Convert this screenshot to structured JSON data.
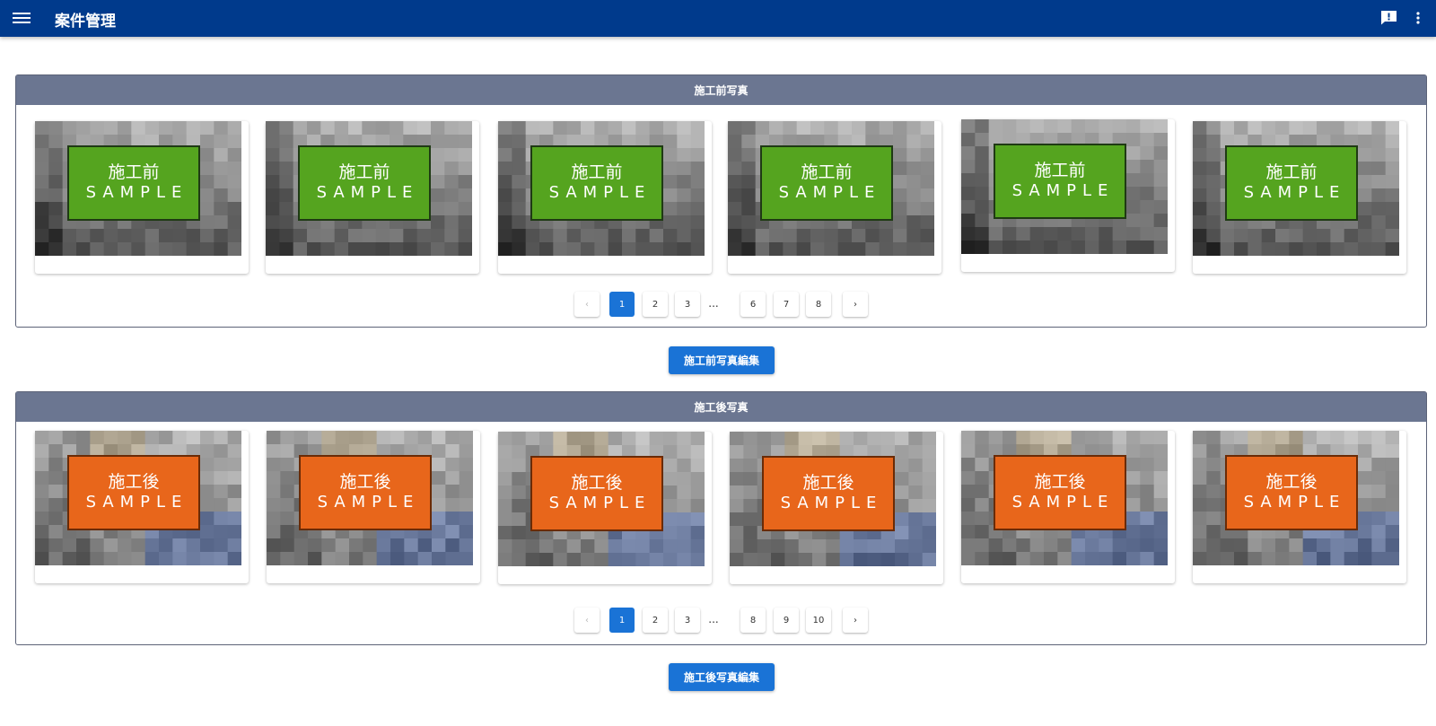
{
  "appbar": {
    "title": "案件管理",
    "menu_icon": "menu-icon",
    "feedback_icon": "feedback-icon",
    "more_icon": "more-vert-icon",
    "color": "#003a8c"
  },
  "before": {
    "header": "施工前写真",
    "photos": [
      {
        "line1": "施工前",
        "line2": "SAMPLE"
      },
      {
        "line1": "施工前",
        "line2": "SAMPLE"
      },
      {
        "line1": "施工前",
        "line2": "SAMPLE"
      },
      {
        "line1": "施工前",
        "line2": "SAMPLE"
      },
      {
        "line1": "施工前",
        "line2": "SAMPLE"
      },
      {
        "line1": "施工前",
        "line2": "SAMPLE"
      }
    ],
    "label_color": "#55a41f",
    "pager": {
      "prev": "‹",
      "pages": [
        "1",
        "2",
        "3",
        "6",
        "7",
        "8"
      ],
      "ellipsis": "...",
      "next": "›",
      "current": "1"
    },
    "edit_button": "施工前写真編集"
  },
  "after": {
    "header": "施工後写真",
    "photos": [
      {
        "line1": "施工後",
        "line2": "SAMPLE"
      },
      {
        "line1": "施工後",
        "line2": "SAMPLE"
      },
      {
        "line1": "施工後",
        "line2": "SAMPLE"
      },
      {
        "line1": "施工後",
        "line2": "SAMPLE"
      },
      {
        "line1": "施工後",
        "line2": "SAMPLE"
      },
      {
        "line1": "施工後",
        "line2": "SAMPLE"
      }
    ],
    "label_color": "#e8661b",
    "pager": {
      "prev": "‹",
      "pages": [
        "1",
        "2",
        "3",
        "8",
        "9",
        "10"
      ],
      "ellipsis": "...",
      "next": "›",
      "current": "1"
    },
    "edit_button": "施工後写真編集"
  }
}
